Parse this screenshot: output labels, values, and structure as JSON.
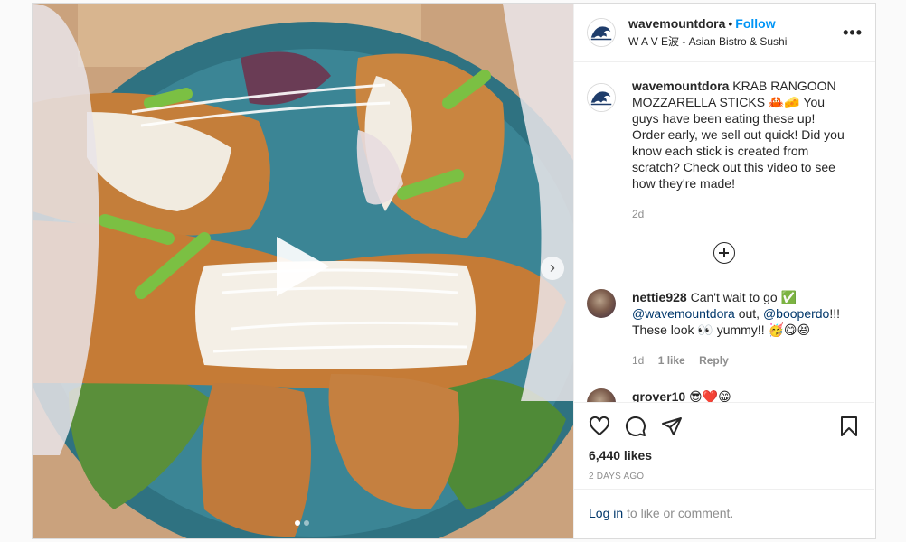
{
  "post": {
    "username": "wavemountdora",
    "follow_label": "Follow",
    "bullet": "•",
    "location": "W A V E波 - Asian Bistro & Sushi",
    "more_icon": "•••"
  },
  "media": {
    "carousel_dots": 2,
    "active_dot": 1,
    "next_icon": "›"
  },
  "caption": {
    "username": "wavemountdora",
    "text": "KRAB RANGOON MOZZARELLA STICKS 🦀🧀 You guys have been eating these up! Order early, we sell out quick! Did you know each stick is created from scratch? Check out this video to see how they're made!",
    "time": "2d"
  },
  "comments": [
    {
      "username": "nettie928",
      "text_before": "Can't wait to go ✅ ",
      "mention1": "@wavemountdora",
      "text_mid": " out, ",
      "mention2": "@booperdo",
      "text_after": "!!! These look 👀 yummy!! 🥳😋😆",
      "time": "1d",
      "likes": "1 like",
      "reply": "Reply"
    },
    {
      "username": "grover10",
      "text": "😎❤️😁"
    }
  ],
  "actions": {
    "likes": "6,440 likes",
    "posted": "2 DAYS AGO"
  },
  "login": {
    "link": "Log in",
    "rest": " to like or comment."
  },
  "colors": {
    "accent": "#0095f6",
    "mention": "#00376b",
    "plate": "#3d7e8c"
  }
}
